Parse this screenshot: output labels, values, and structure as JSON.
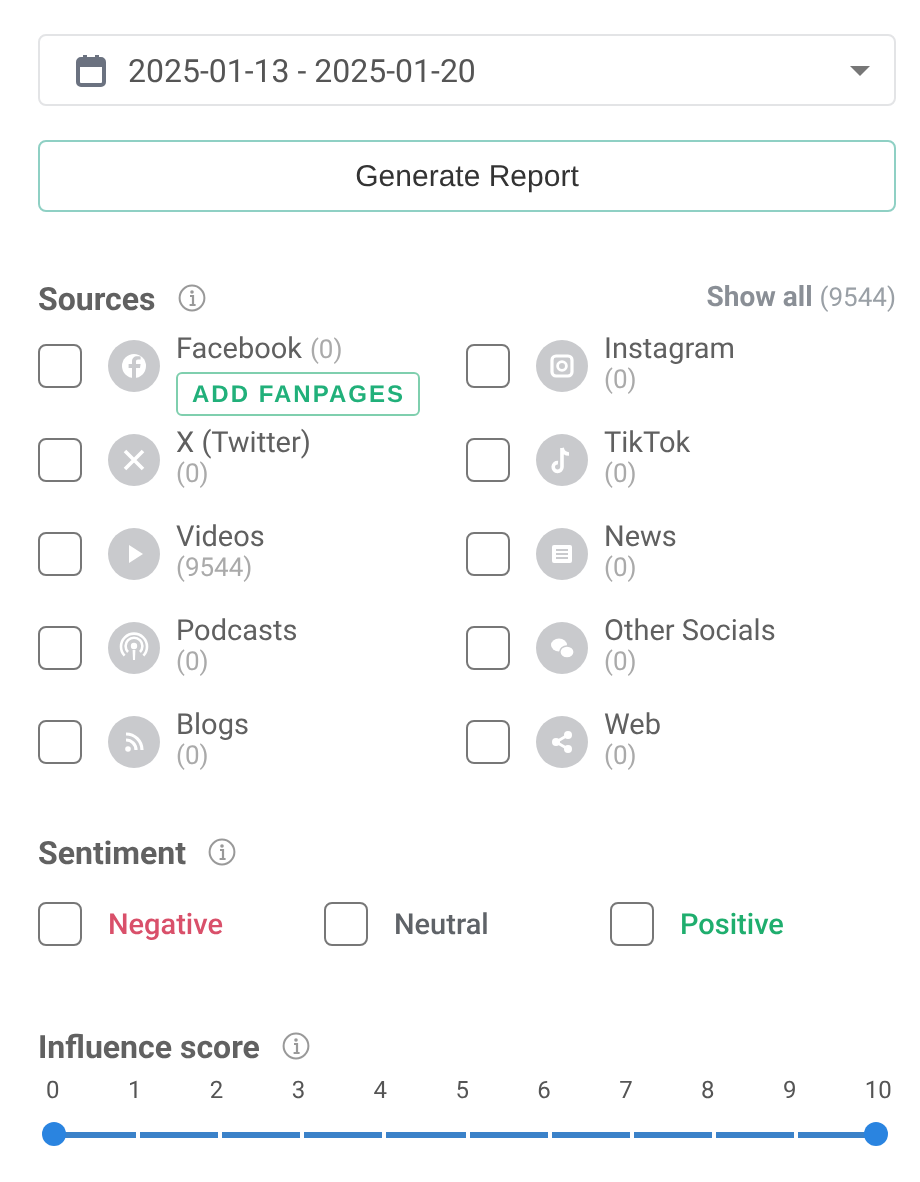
{
  "date_range": {
    "value": "2025-01-13 - 2025-01-20"
  },
  "generate_button": "Generate Report",
  "sources": {
    "title": "Sources",
    "show_all": "Show all",
    "show_all_count": "(9544)",
    "items": [
      {
        "name": "Facebook",
        "count": "(0)",
        "checked": false,
        "action": "ADD FANPAGES"
      },
      {
        "name": "Instagram",
        "count": "(0)",
        "checked": false
      },
      {
        "name": "X (Twitter)",
        "count": "(0)",
        "checked": false
      },
      {
        "name": "TikTok",
        "count": "(0)",
        "checked": false
      },
      {
        "name": "Videos",
        "count": "(9544)",
        "checked": false
      },
      {
        "name": "News",
        "count": "(0)",
        "checked": false
      },
      {
        "name": "Podcasts",
        "count": "(0)",
        "checked": false
      },
      {
        "name": "Other Socials",
        "count": "(0)",
        "checked": false
      },
      {
        "name": "Blogs",
        "count": "(0)",
        "checked": false
      },
      {
        "name": "Web",
        "count": "(0)",
        "checked": false
      }
    ]
  },
  "sentiment": {
    "title": "Sentiment",
    "items": [
      {
        "label": "Negative",
        "checked": false,
        "color": "#d9506a"
      },
      {
        "label": "Neutral",
        "checked": false,
        "color": "#5f6368"
      },
      {
        "label": "Positive",
        "checked": false,
        "color": "#1fae6e"
      }
    ]
  },
  "influence": {
    "title": "Influence score",
    "ticks": [
      "0",
      "1",
      "2",
      "3",
      "4",
      "5",
      "6",
      "7",
      "8",
      "9",
      "10"
    ],
    "thumbs": [
      {
        "level": 0
      },
      {
        "level": 1
      }
    ]
  }
}
